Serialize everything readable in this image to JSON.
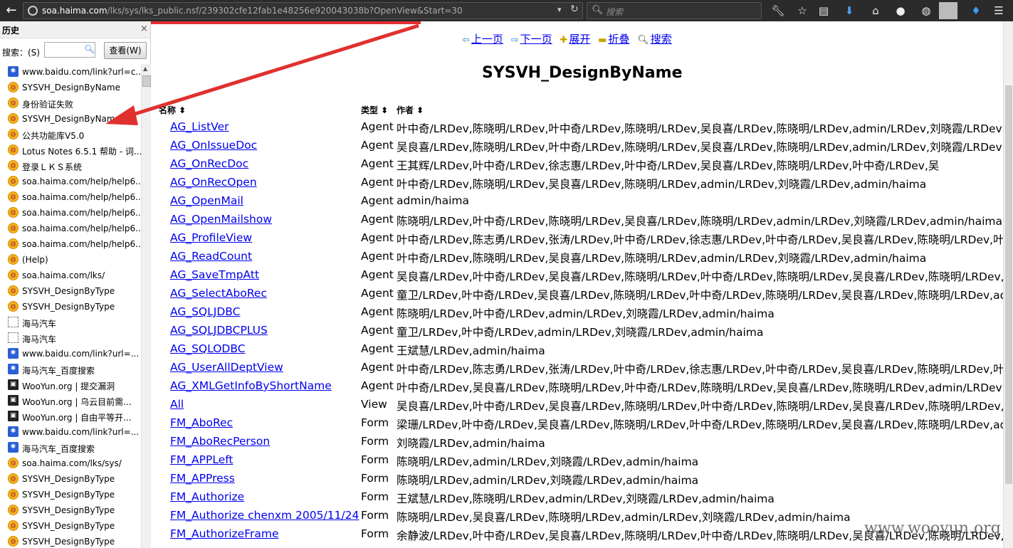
{
  "browser": {
    "url_host": "soa.haima.com",
    "url_path": "/lks/sys/lks_public.nsf/239302cfe12fab1e48256e920043038b?OpenView&Start=30",
    "search_placeholder": "搜索",
    "back_glyph": "←",
    "reload_glyph": "↻",
    "dropdown_glyph": "▾",
    "icons": [
      "wrench-icon",
      "star-icon",
      "reading-list-icon",
      "download-icon",
      "home-icon",
      "chat-icon",
      "globe-icon",
      "profile-icon",
      "flame-icon",
      "menu-icon"
    ],
    "accent_color": "#e0312f"
  },
  "sidebar": {
    "title": "历史",
    "close": "×",
    "search_label": "搜索：(S)",
    "view_button": "查看(W)",
    "items": [
      {
        "icon": "baidu",
        "label": "www.baidu.com/link?url=c..."
      },
      {
        "icon": "haima",
        "label": "SYSVH_DesignByName"
      },
      {
        "icon": "haima",
        "label": "身份验证失败"
      },
      {
        "icon": "haima",
        "label": "SYSVH_DesignByName"
      },
      {
        "icon": "haima",
        "label": "公共功能库V5.0"
      },
      {
        "icon": "haima",
        "label": "Lotus Notes 6.5.1 帮助 - 词..."
      },
      {
        "icon": "haima",
        "label": "登录ＬＫＳ系统"
      },
      {
        "icon": "haima",
        "label": "soa.haima.com/help/help6..."
      },
      {
        "icon": "haima",
        "label": "soa.haima.com/help/help6..."
      },
      {
        "icon": "haima",
        "label": "soa.haima.com/help/help6..."
      },
      {
        "icon": "haima",
        "label": "soa.haima.com/help/help6..."
      },
      {
        "icon": "haima",
        "label": "soa.haima.com/help/help6..."
      },
      {
        "icon": "haima",
        "label": "(Help)"
      },
      {
        "icon": "haima",
        "label": "soa.haima.com/lks/"
      },
      {
        "icon": "haima",
        "label": "SYSVH_DesignByType"
      },
      {
        "icon": "haima",
        "label": "SYSVH_DesignByType"
      },
      {
        "icon": "blank",
        "label": "海马汽车"
      },
      {
        "icon": "blank",
        "label": "海马汽车"
      },
      {
        "icon": "baidu",
        "label": "www.baidu.com/link?url=..."
      },
      {
        "icon": "baidu",
        "label": "海马汽车_百度搜索"
      },
      {
        "icon": "wooyun",
        "label": "WooYun.org | 提交漏洞"
      },
      {
        "icon": "wooyun",
        "label": "WooYun.org | 乌云目前需..."
      },
      {
        "icon": "wooyun",
        "label": "WooYun.org | 自由平等开..."
      },
      {
        "icon": "baidu",
        "label": "www.baidu.com/link?url=..."
      },
      {
        "icon": "baidu",
        "label": "海马汽车_百度搜索"
      },
      {
        "icon": "haima",
        "label": "soa.haima.com/lks/sys/"
      },
      {
        "icon": "haima",
        "label": "SYSVH_DesignByType"
      },
      {
        "icon": "haima",
        "label": "SYSVH_DesignByType"
      },
      {
        "icon": "haima",
        "label": "SYSVH_DesignByType"
      },
      {
        "icon": "haima",
        "label": "SYSVH_DesignByType"
      },
      {
        "icon": "haima",
        "label": "SYSVH_DesignByType"
      }
    ]
  },
  "nav": {
    "prev": "上一页",
    "next": "下一页",
    "expand": "展开",
    "collapse": "折叠",
    "search": "搜索"
  },
  "page_title": "SYSVH_DesignByName",
  "columns": {
    "name": "名称 ⬍",
    "type": "类型 ⬍",
    "author": "作者 ⬍"
  },
  "rows": [
    {
      "name": "AG_ListVer",
      "type": "Agent",
      "author": "叶中奇/LRDev,陈晓明/LRDev,叶中奇/LRDev,陈晓明/LRDev,吴良喜/LRDev,陈晓明/LRDev,admin/LRDev,刘晓霞/LRDev,a"
    },
    {
      "name": "AG_OnIssueDoc",
      "type": "Agent",
      "author": "吴良喜/LRDev,陈晓明/LRDev,叶中奇/LRDev,陈晓明/LRDev,吴良喜/LRDev,陈晓明/LRDev,admin/LRDev,刘晓霞/LRDev,a"
    },
    {
      "name": "AG_OnRecDoc",
      "type": "Agent",
      "author": "王其辉/LRDev,叶中奇/LRDev,徐志惠/LRDev,叶中奇/LRDev,吴良喜/LRDev,陈晓明/LRDev,叶中奇/LRDev,吴"
    },
    {
      "name": "AG_OnRecOpen",
      "type": "Agent",
      "author": "叶中奇/LRDev,陈晓明/LRDev,吴良喜/LRDev,陈晓明/LRDev,admin/LRDev,刘晓霞/LRDev,admin/haima"
    },
    {
      "name": "AG_OpenMail",
      "type": "Agent",
      "author": "admin/haima"
    },
    {
      "name": "AG_OpenMailshow",
      "type": "Agent",
      "author": "陈晓明/LRDev,叶中奇/LRDev,陈晓明/LRDev,吴良喜/LRDev,陈晓明/LRDev,admin/LRDev,刘晓霞/LRDev,admin/haima"
    },
    {
      "name": "AG_ProfileView",
      "type": "Agent",
      "author": "叶中奇/LRDev,陈志勇/LRDev,张涛/LRDev,叶中奇/LRDev,徐志惠/LRDev,叶中奇/LRDev,吴良喜/LRDev,陈晓明/LRDev,叶中"
    },
    {
      "name": "AG_ReadCount",
      "type": "Agent",
      "author": "叶中奇/LRDev,陈晓明/LRDev,吴良喜/LRDev,陈晓明/LRDev,admin/LRDev,刘晓霞/LRDev,admin/haima"
    },
    {
      "name": "AG_SaveTmpAtt",
      "type": "Agent",
      "author": "吴良喜/LRDev,叶中奇/LRDev,吴良喜/LRDev,陈晓明/LRDev,叶中奇/LRDev,陈晓明/LRDev,吴良喜/LRDev,陈晓明/LRDev,a"
    },
    {
      "name": "AG_SelectAboRec",
      "type": "Agent",
      "author": "童卫/LRDev,叶中奇/LRDev,吴良喜/LRDev,陈晓明/LRDev,叶中奇/LRDev,陈晓明/LRDev,吴良喜/LRDev,陈晓明/LRDev,adr"
    },
    {
      "name": "AG_SQLJDBC",
      "type": "Agent",
      "author": "陈晓明/LRDev,叶中奇/LRDev,admin/LRDev,刘晓霞/LRDev,admin/haima"
    },
    {
      "name": "AG_SQLJDBCPLUS",
      "type": "Agent",
      "author": "童卫/LRDev,叶中奇/LRDev,admin/LRDev,刘晓霞/LRDev,admin/haima"
    },
    {
      "name": "AG_SQLODBC",
      "type": "Agent",
      "author": "王斌慧/LRDev,admin/haima"
    },
    {
      "name": "AG_UserAllDeptView",
      "type": "Agent",
      "author": "叶中奇/LRDev,陈志勇/LRDev,张涛/LRDev,叶中奇/LRDev,徐志惠/LRDev,叶中奇/LRDev,吴良喜/LRDev,陈晓明/LRDev,叶中"
    },
    {
      "name": "AG_XMLGetInfoByShortName",
      "type": "Agent",
      "author": "叶中奇/LRDev,吴良喜/LRDev,陈晓明/LRDev,叶中奇/LRDev,陈晓明/LRDev,吴良喜/LRDev,陈晓明/LRDev,admin/LRDev,刘"
    },
    {
      "name": "All",
      "type": "View",
      "author": "吴良喜/LRDev,叶中奇/LRDev,吴良喜/LRDev,陈晓明/LRDev,叶中奇/LRDev,陈晓明/LRDev,吴良喜/LRDev,陈晓明/LRDev,a"
    },
    {
      "name": "FM_AboRec",
      "type": "Form",
      "author": "梁珊/LRDev,叶中奇/LRDev,吴良喜/LRDev,陈晓明/LRDev,叶中奇/LRDev,陈晓明/LRDev,吴良喜/LRDev,陈晓明/LRDev,adr"
    },
    {
      "name": "FM_AboRecPerson",
      "type": "Form",
      "author": "刘晓霞/LRDev,admin/haima"
    },
    {
      "name": "FM_APPLeft",
      "type": "Form",
      "author": "陈晓明/LRDev,admin/LRDev,刘晓霞/LRDev,admin/haima"
    },
    {
      "name": "FM_APPress",
      "type": "Form",
      "author": "陈晓明/LRDev,admin/LRDev,刘晓霞/LRDev,admin/haima"
    },
    {
      "name": "FM_Authorize",
      "type": "Form",
      "author": "王斌慧/LRDev,陈晓明/LRDev,admin/LRDev,刘晓霞/LRDev,admin/haima"
    },
    {
      "name": "FM_Authorize chenxm 2005/11/24",
      "type": "Form",
      "author": "陈晓明/LRDev,吴良喜/LRDev,陈晓明/LRDev,admin/LRDev,刘晓霞/LRDev,admin/haima"
    },
    {
      "name": "FM_AuthorizeFrame",
      "type": "Form",
      "author": "余静波/LRDev,叶中奇/LRDev,吴良喜/LRDev,陈晓明/LRDev,叶中奇/LRDev,陈晓明/LRDev,吴良喜/LRDev,陈晓明/LRDev,adr"
    }
  ],
  "watermark": "www.wooyun.org"
}
